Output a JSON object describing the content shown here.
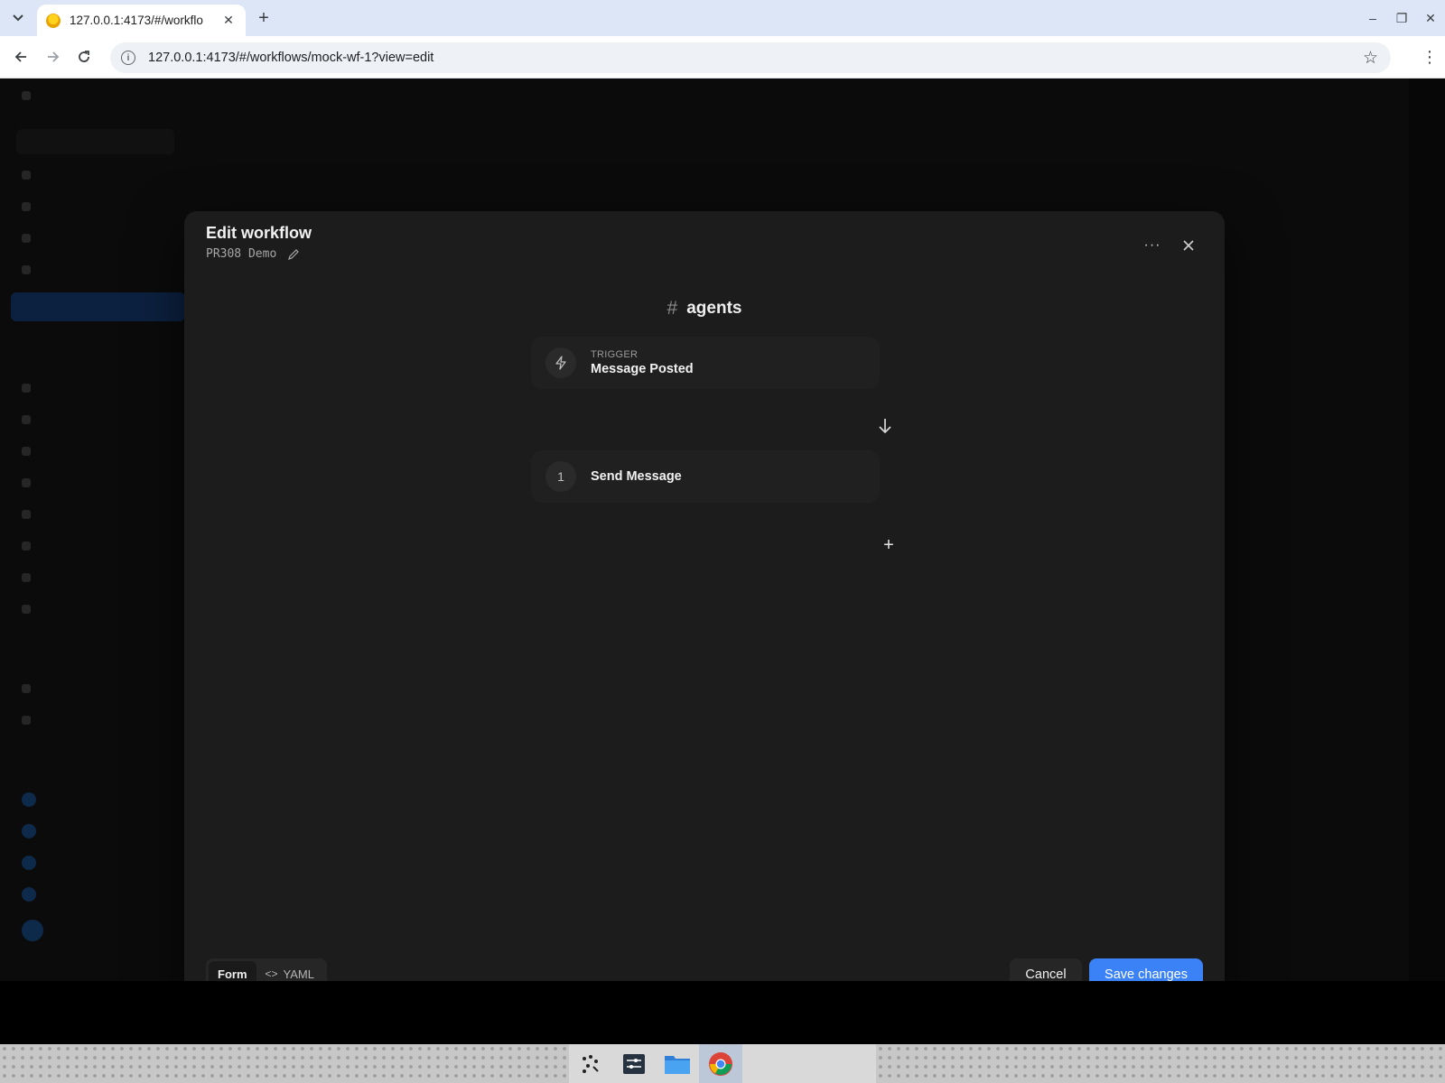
{
  "browser": {
    "tab_title": "127.0.0.1:4173/#/workflo",
    "tab_close": "✕",
    "new_tab": "+",
    "url": "127.0.0.1:4173/#/workflows/mock-wf-1?view=edit",
    "window_controls": {
      "minimize": "–",
      "restore": "❐",
      "close": "✕"
    }
  },
  "modal": {
    "title": "Edit workflow",
    "subtitle": "PR308 Demo",
    "more_label": "···",
    "channel": {
      "hash": "#",
      "name": "agents"
    },
    "trigger": {
      "kicker": "TRIGGER",
      "name": "Message Posted"
    },
    "steps": [
      {
        "number": "1",
        "name": "Send Message"
      }
    ],
    "add_step": "+",
    "view_toggle": {
      "form": "Form",
      "yaml_glyph": "<>",
      "yaml": "YAML"
    },
    "cancel_label": "Cancel",
    "save_label": "Save changes"
  },
  "colors": {
    "accent": "#3b82f6",
    "modal_bg": "#1c1c1c",
    "card_bg": "#202020"
  },
  "icons": {
    "trigger": "lightning-icon",
    "edit": "pencil-icon",
    "close": "close-icon",
    "arrow": "arrow-down-icon"
  }
}
